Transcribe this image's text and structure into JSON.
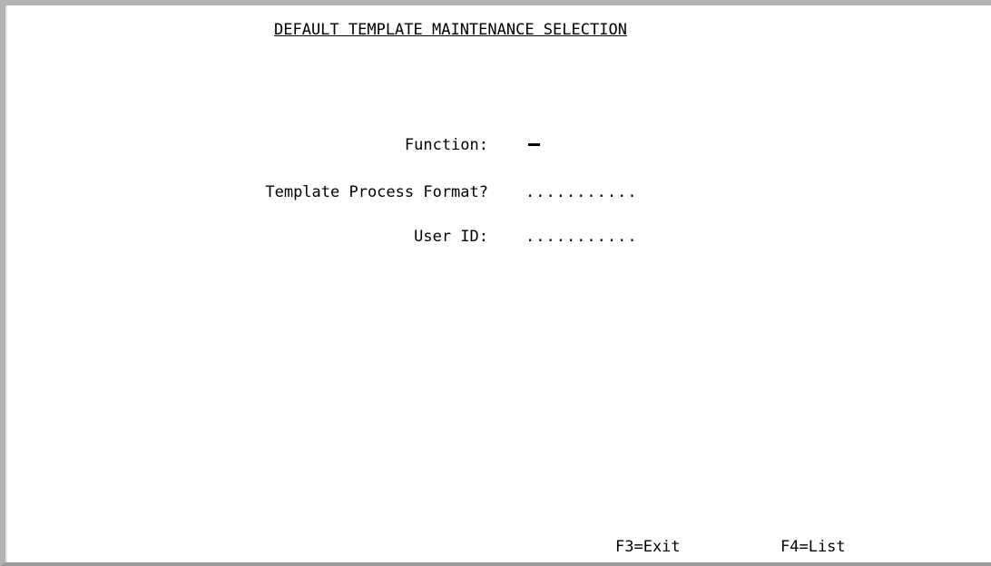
{
  "screen": {
    "title": "DEFAULT TEMPLATE MAINTENANCE SELECTION"
  },
  "form": {
    "function_label": "Function:",
    "function_value": "",
    "template_format_label": "Template Process Format?",
    "template_format_value": "...........",
    "user_id_label": "User ID:",
    "user_id_value": "..........."
  },
  "function_keys": {
    "exit": "F3=Exit",
    "list": "F4=List"
  }
}
